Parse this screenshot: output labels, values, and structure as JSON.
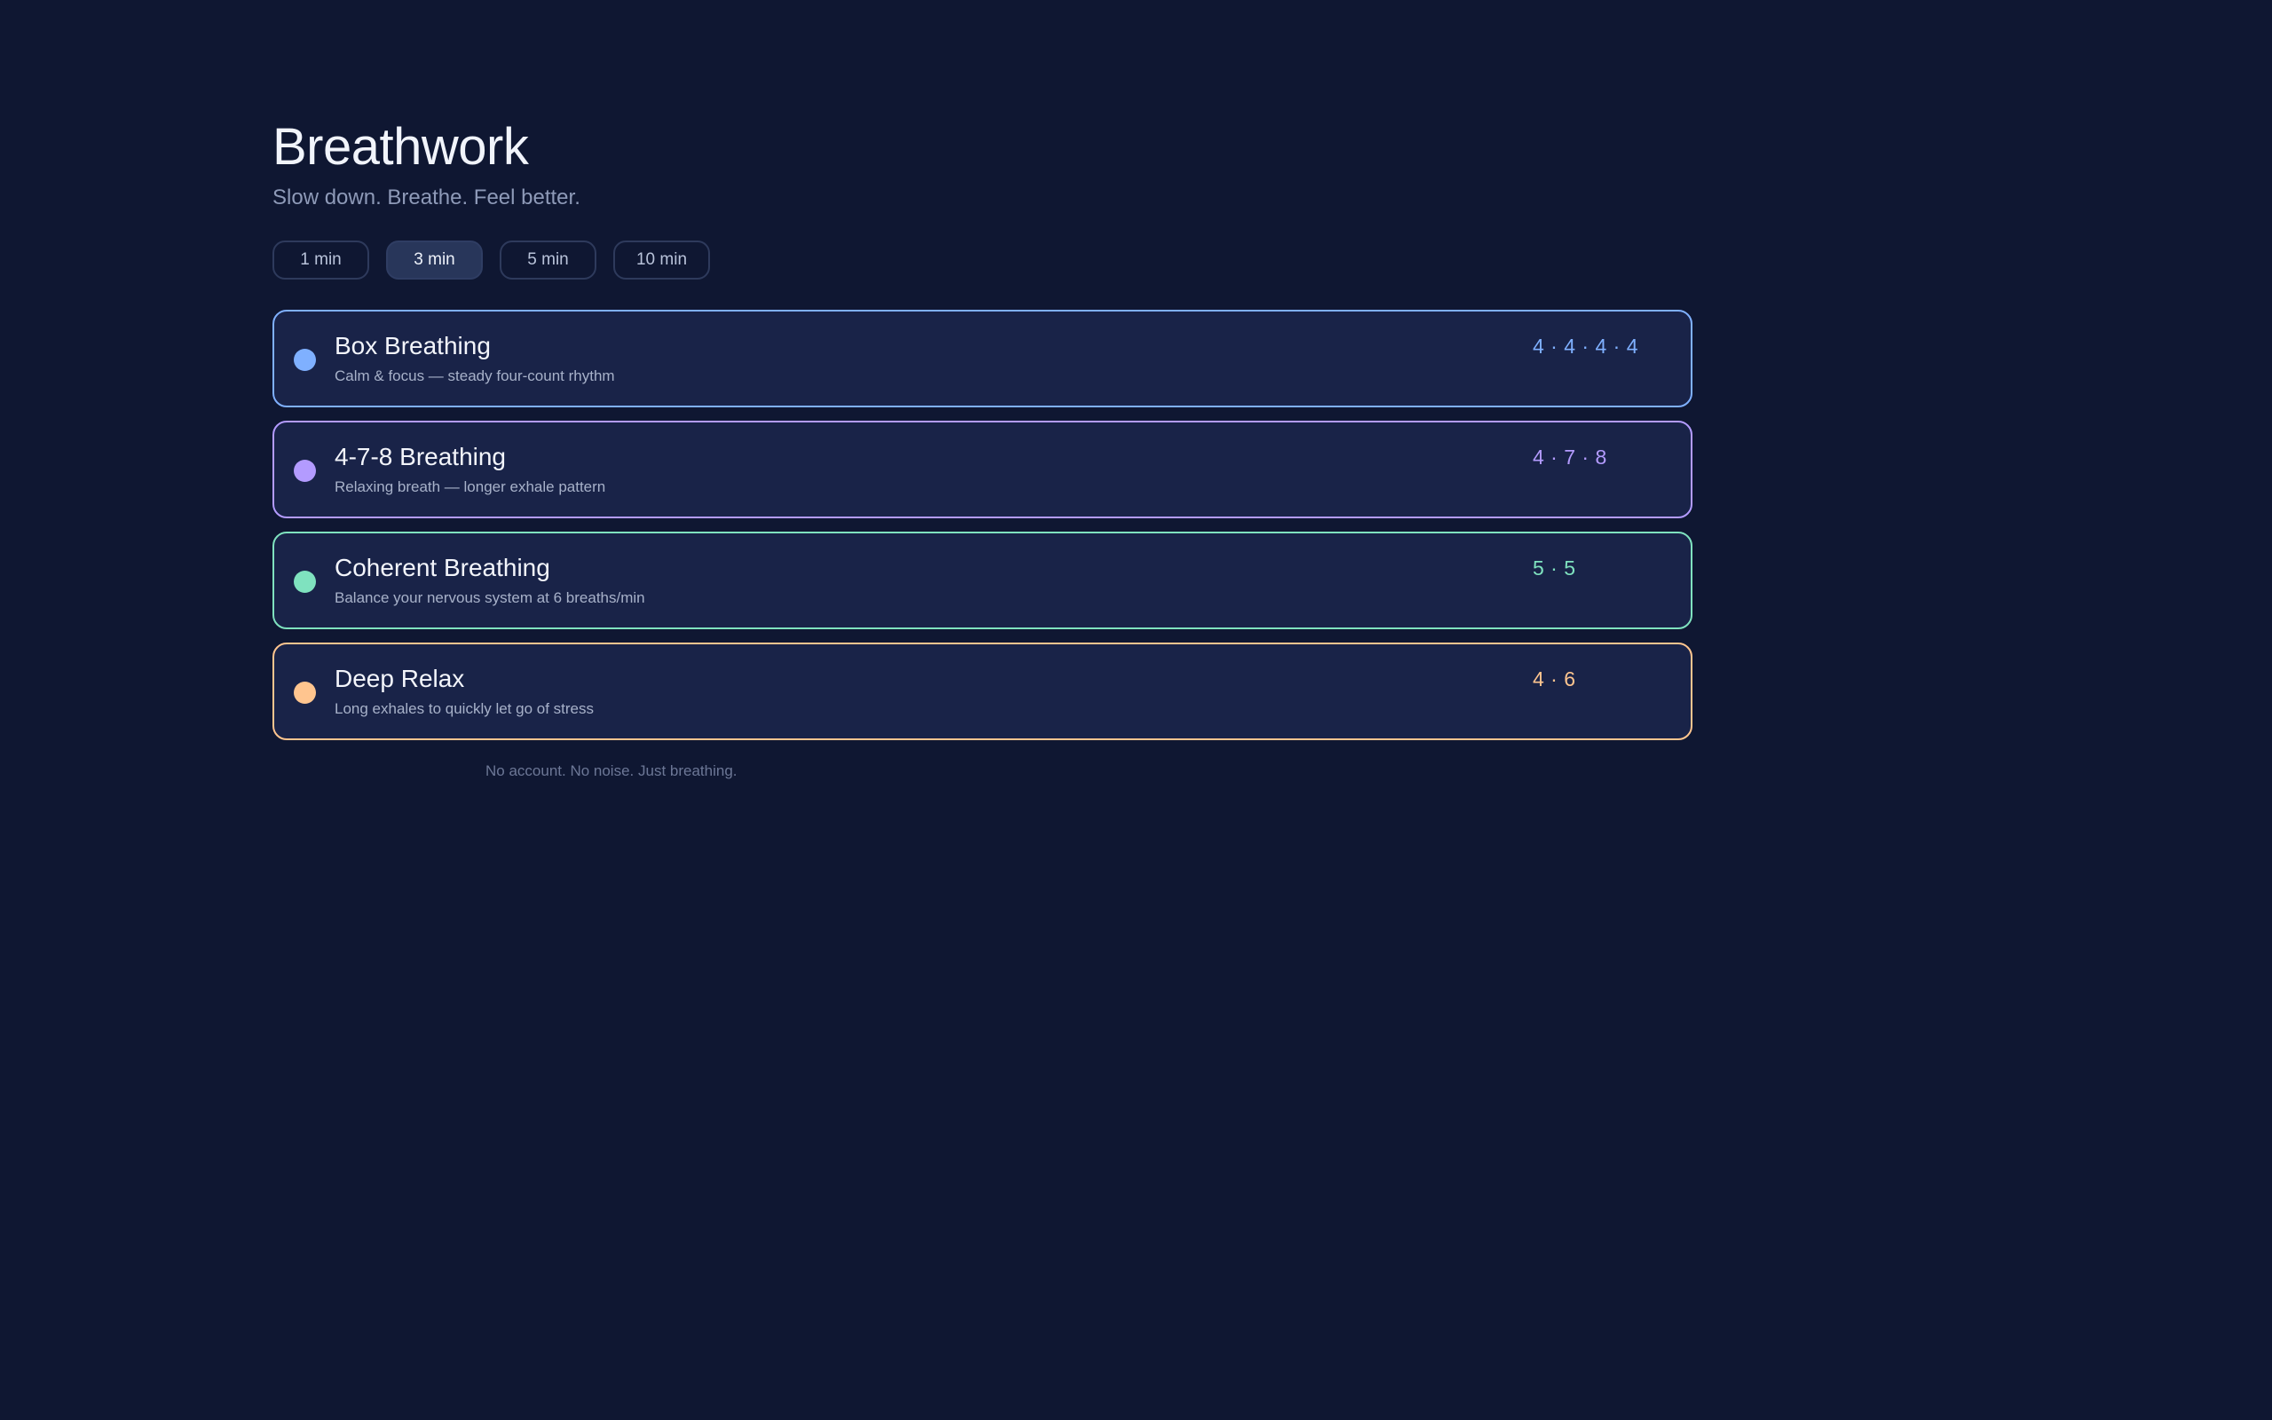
{
  "header": {
    "title": "Breathwork",
    "subtitle": "Slow down. Breathe. Feel better."
  },
  "durations": {
    "options": [
      "1 min",
      "3 min",
      "5 min",
      "10 min"
    ],
    "selected": "3 min"
  },
  "exercises": [
    {
      "name": "Box Breathing",
      "description": "Calm & focus — steady four-count rhythm",
      "pattern": "4 · 4 · 4 · 4",
      "color": "#7fb0ff"
    },
    {
      "name": "4-7-8 Breathing",
      "description": "Relaxing breath — longer exhale pattern",
      "pattern": "4 · 7 · 8",
      "color": "#b39bff"
    },
    {
      "name": "Coherent Breathing",
      "description": "Balance your nervous system at 6 breaths/min",
      "pattern": "5 · 5",
      "color": "#7fe2bf"
    },
    {
      "name": "Deep Relax",
      "description": "Long exhales to quickly let go of stress",
      "pattern": "4 · 6",
      "color": "#ffc58f"
    }
  ],
  "footer": {
    "text": "No account. No noise. Just breathing."
  }
}
